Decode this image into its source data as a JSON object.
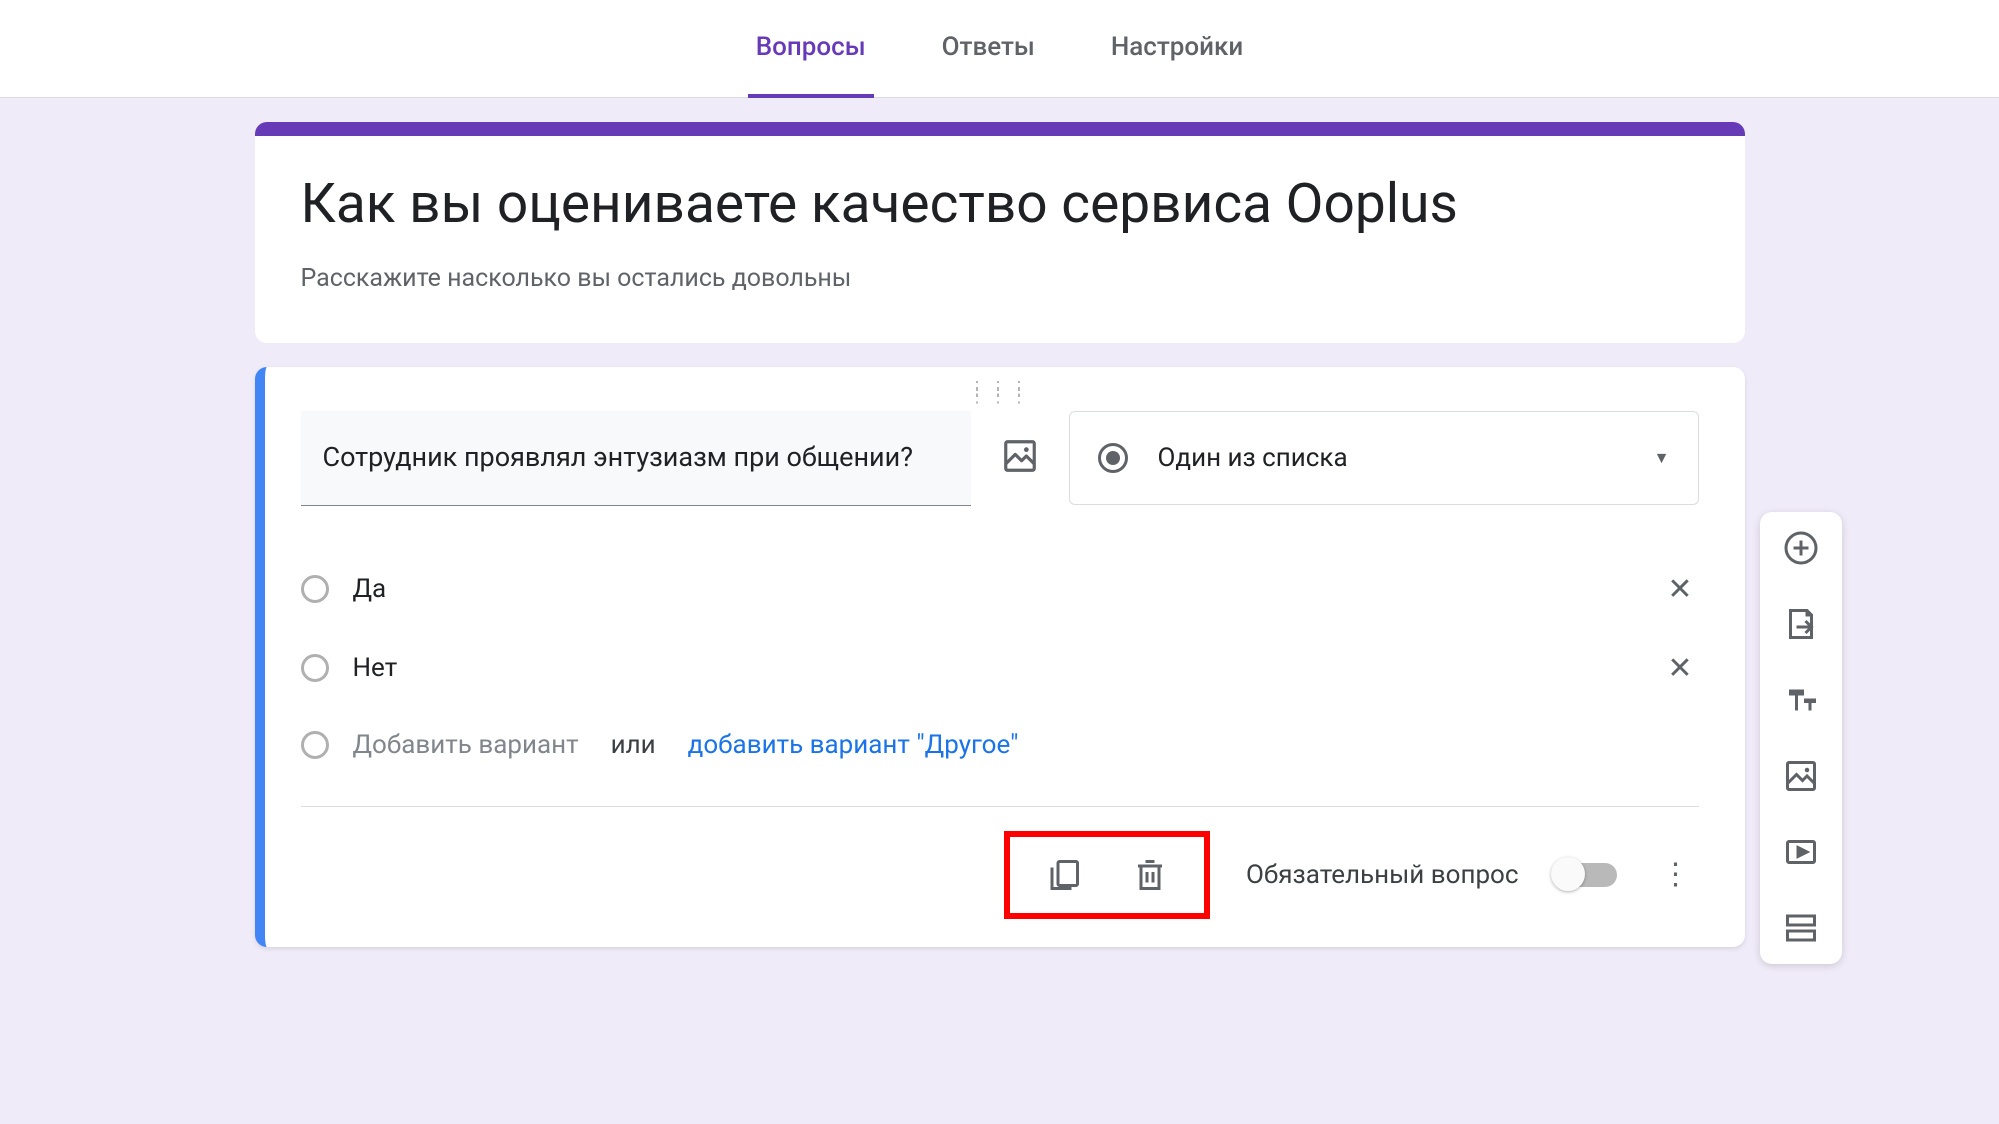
{
  "tabs": {
    "questions": "Вопросы",
    "answers": "Ответы",
    "settings": "Настройки"
  },
  "header": {
    "title": "Как вы оцениваете качество сервиса Ooplus",
    "description": "Расскажите насколько вы остались довольны"
  },
  "question": {
    "text": "Сотрудник проявлял энтузиазм при общении?",
    "type_label": "Один из списка",
    "options": [
      "Да",
      "Нет"
    ],
    "add_option": "Добавить вариант",
    "or_text": "или",
    "add_other": "добавить вариант \"Другое\"",
    "required_label": "Обязательный вопрос"
  }
}
